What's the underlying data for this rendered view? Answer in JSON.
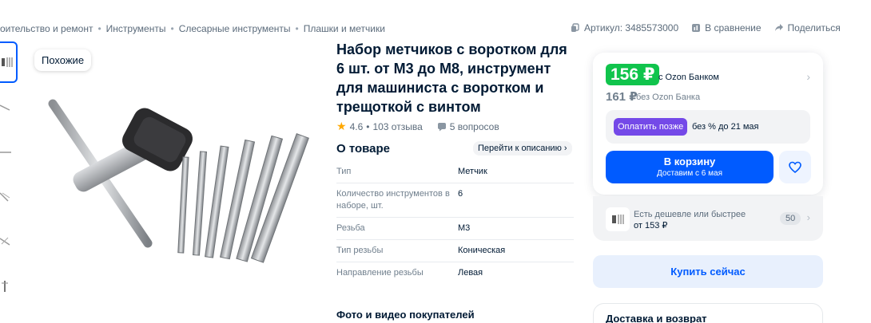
{
  "breadcrumbs": [
    "оительство и ремонт",
    "Инструменты",
    "Слесарные инструменты",
    "Плашки и метчики"
  ],
  "top_actions": {
    "article": "Артикул: 3485573000",
    "compare": "В сравнение",
    "share": "Поделиться"
  },
  "similar_label": "Похожие",
  "product": {
    "title": "Набор метчиков с воротком для 6 шт. от М3 до М8, инструмент для машиниста с воротком и трещоткой с винтом",
    "rating": "4.6",
    "reviews": "103 отзыва",
    "questions": "5 вопросов"
  },
  "about": {
    "heading": "О товаре",
    "link": "Перейти к описанию",
    "specs": [
      {
        "key": "Тип",
        "value": "Метчик"
      },
      {
        "key": "Количество инструментов в наборе, шт.",
        "value": "6"
      },
      {
        "key": "Резьба",
        "value": "М3"
      },
      {
        "key": "Тип резьбы",
        "value": "Коническая"
      },
      {
        "key": "Направление резьбы",
        "value": "Левая"
      }
    ],
    "photo_heading": "Фото и видео покупателей"
  },
  "price_card": {
    "price_ozon": "156 ₽",
    "ozon_label": "с Ozon Банком",
    "price_regular": "161 ₽",
    "regular_label": "без Ozon Банка",
    "bnpl_button": "Оплатить позже",
    "bnpl_text": "без % до 21 мая",
    "cart_label": "В корзину",
    "cart_sub": "Доставим с 6 мая"
  },
  "cheaper": {
    "line1": "Есть дешевле или быстрее",
    "line2": "от 153 ₽",
    "count": "50"
  },
  "buy_now": "Купить сейчас",
  "delivery_heading": "Доставка и возврат",
  "colors": {
    "accent": "#005bff",
    "price_green": "#10c44c",
    "bnpl_purple": "#7449e8",
    "star": "#ffa800"
  }
}
